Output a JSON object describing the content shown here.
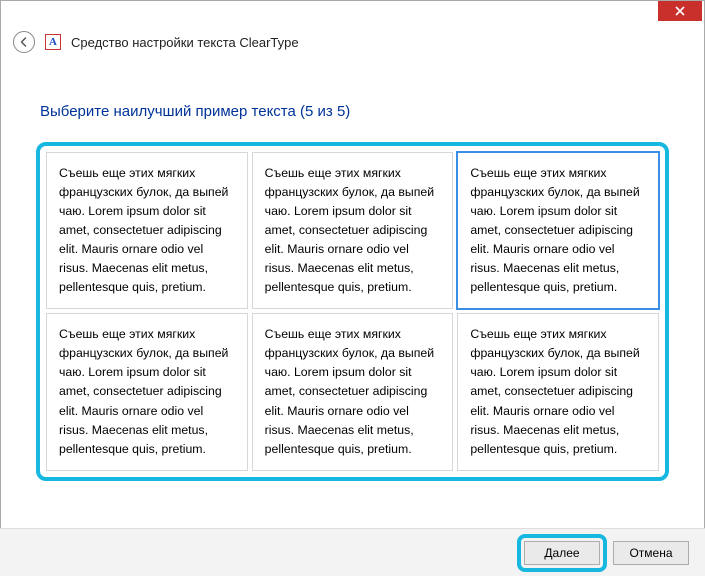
{
  "window": {
    "title": "Средство настройки текста ClearType"
  },
  "instruction": "Выберите наилучший пример текста (5 из 5)",
  "sample_text": "Съешь еще этих мягких французских булок, да выпей чаю. Lorem ipsum dolor sit amet, consectetuer adipiscing elit. Mauris ornare odio vel risus. Maecenas elit metus, pellentesque quis, pretium.",
  "selected_index": 2,
  "buttons": {
    "next": "Далее",
    "cancel": "Отмена"
  },
  "icon_letter": "A",
  "highlight_color": "#17b8e0"
}
